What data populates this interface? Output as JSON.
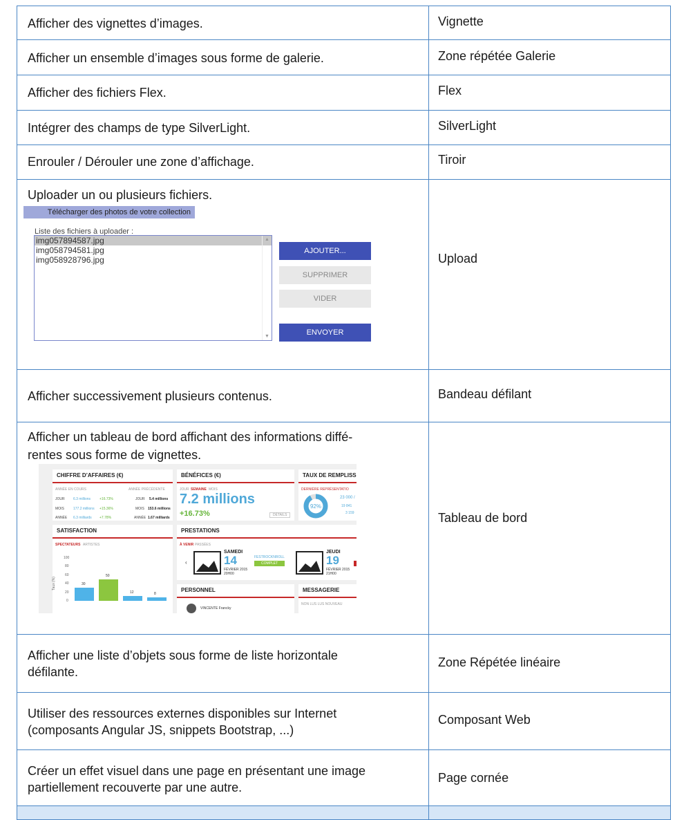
{
  "rows": [
    {
      "desc": "Afficher des vignettes d’images.",
      "ctrl": "Vignette"
    },
    {
      "desc": "Afficher un ensemble d’images sous forme de galerie.",
      "ctrl": "Zone répétée Galerie"
    },
    {
      "desc": "Afficher des fichiers Flex.",
      "ctrl": "Flex"
    },
    {
      "desc": "Intégrer des champs de type SilverLight.",
      "ctrl": "SilverLight"
    },
    {
      "desc": "Enrouler / Dérouler une zone d’affichage.",
      "ctrl": "Tiroir"
    },
    {
      "desc": "Uploader un ou plusieurs fichiers.",
      "ctrl": "Upload"
    },
    {
      "desc": "Afficher successivement plusieurs contenus.",
      "ctrl": "Bandeau défilant"
    },
    {
      "desc_l1": "Afficher un tableau de bord affichant des informations diffé-",
      "desc_l2": "rentes sous forme de vignettes.",
      "ctrl": "Tableau de bord"
    },
    {
      "desc_l1": "Afficher une liste d’objets sous forme de liste horizontale",
      "desc_l2": "défilante.",
      "ctrl": "Zone Répétée linéaire"
    },
    {
      "desc_l1": "Utiliser des ressources externes disponibles sur Internet",
      "desc_l2": "(composants Angular JS, snippets Bootstrap, ...)",
      "ctrl": "Composant Web"
    },
    {
      "desc_l1": "Créer un effet visuel dans une page en présentant une image",
      "desc_l2": "partiellement recouverte par une autre.",
      "ctrl": "Page cornée"
    }
  ],
  "upload": {
    "banner": "Télécharger des photos de votre collection",
    "list_label": "Liste des fichiers à uploader :",
    "files": [
      "img057894587.jpg",
      "img058794581.jpg",
      "img058928796.jpg"
    ],
    "btn_add": "AJOUTER...",
    "btn_delete": "SUPPRIMER",
    "btn_clear": "VIDER",
    "btn_send": "ENVOYER"
  },
  "dashboard": {
    "ca_title": "CHIFFRE D’AFFAIRES (€)",
    "ca_cur": "ANNÉE EN COURS",
    "ca_prev": "ANNÉE PRÉCÉDENTE",
    "ca_day": "JOUR",
    "ca_day_v": "6.3 millions",
    "ca_day_p": "+16.73%",
    "ca_day_prev": "5.4 millions",
    "ca_month": "MOIS",
    "ca_month_v": "177.2 millions",
    "ca_month_p": "+15.36%",
    "ca_month_prev": "153.6 millions",
    "ca_year": "ANNÉE",
    "ca_year_v": "6.3 milliards",
    "ca_year_p": "+7.78%",
    "ca_year_prev": "1.67 milliards",
    "ben_title": "BÉNÉFICES (€)",
    "ben_tabs": [
      "JOUR",
      "SEMAINE",
      "MOIS"
    ],
    "ben_value": "7.2 millions",
    "ben_pct": "+16.73%",
    "ben_details": "DÉTAILS",
    "taux_title": "TAUX DE REMPLISS",
    "taux_sub": "DERNIÈRE REPRÉSENTATIO",
    "taux_pct": "92%",
    "taux_v1": "23 000 /",
    "taux_v2": "19 841",
    "taux_v3": "3 159",
    "sat_title": "SATISFACTION",
    "sat_tab1": "SPECTATEURS",
    "sat_tab2": "ARTISTES",
    "sat_ylabel": "Taux (%)",
    "sat_yticks": [
      "100",
      "80",
      "60",
      "40",
      "20",
      "0"
    ],
    "prest_title": "PRESTATIONS",
    "prest_tab1": "À VENIR",
    "prest_tab2": "PASSÉES",
    "ev1_day": "SAMEDI",
    "ev1_num": "14",
    "ev1_date": "FÉVRIER 2015",
    "ev1_time": "20H00",
    "ev1_name": "FESTROCKNROLL",
    "ev1_status": "COMPLET",
    "ev2_day": "JEUDI",
    "ev2_num": "19",
    "ev2_date": "FÉVRIER 2015",
    "ev2_time": "21H00",
    "perso_title": "PERSONNEL",
    "perso_name": "VINCENTE Francky",
    "msg_title": "MESSAGERIE",
    "msg_tabs": "NON LUS  LUS  NOUVEAU"
  },
  "chart_data": {
    "type": "bar",
    "ylim": [
      0,
      100
    ],
    "ylabel": "Taux (%)",
    "series": [
      {
        "values": [
          30,
          50,
          12,
          8
        ]
      }
    ],
    "colors": [
      "#4fb3e8",
      "#8cc63f",
      "#4fb3e8",
      "#4fb3e8"
    ]
  }
}
